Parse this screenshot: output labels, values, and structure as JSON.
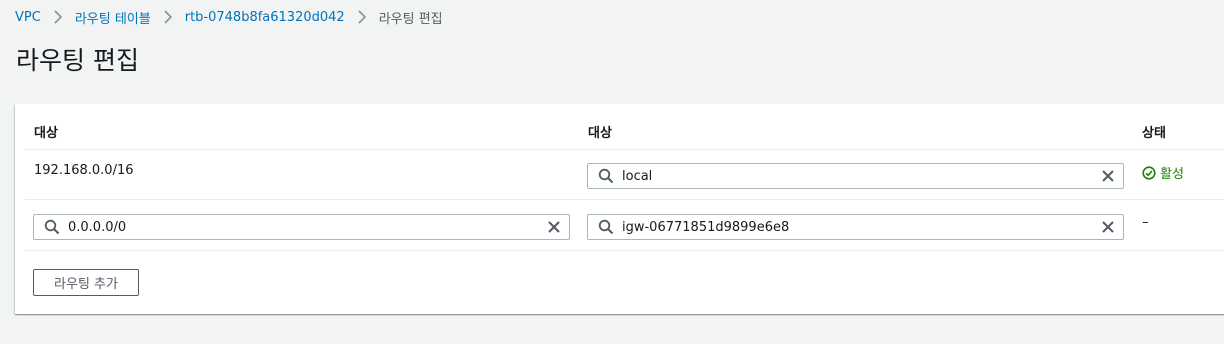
{
  "breadcrumb": {
    "items": [
      {
        "label": "VPC"
      },
      {
        "label": "라우팅 테이블"
      },
      {
        "label": "rtb-0748b8fa61320d042"
      },
      {
        "label": "라우팅 편집"
      }
    ]
  },
  "page": {
    "title": "라우팅 편집"
  },
  "table": {
    "headers": {
      "destination": "대상",
      "target": "대상",
      "status": "상태"
    },
    "rows": [
      {
        "destination": "192.168.0.0/16",
        "target": "local",
        "status": "활성"
      },
      {
        "destination": "0.0.0.0/0",
        "target": "igw-06771851d9899e6e8",
        "status": "–"
      }
    ]
  },
  "actions": {
    "add_route_label": "라우팅 추가"
  },
  "icons": {
    "breadcrumb_separator": "chevron-right-icon",
    "input_prefix": "search-icon",
    "input_clear": "close-icon",
    "status_active": "check-circle-icon"
  },
  "colors": {
    "link": "#0073bb",
    "status_active": "#1d8102",
    "background": "#f2f3f3"
  }
}
